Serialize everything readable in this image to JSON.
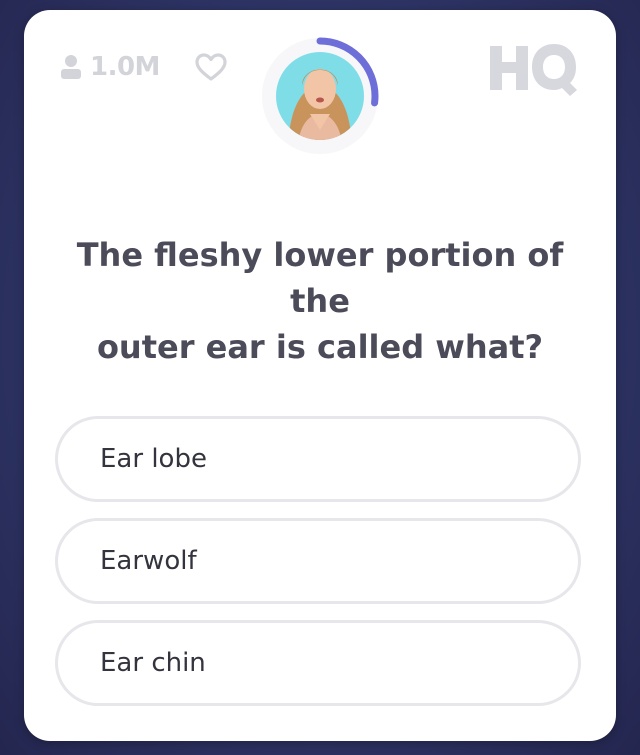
{
  "header": {
    "viewer_count": "1.0M",
    "logo_text": "HQ",
    "timer_progress": 0.27,
    "icons": {
      "viewers": "person-icon",
      "like": "heart-icon",
      "host": "host-avatar"
    }
  },
  "question": {
    "line1": "The fleshy lower portion of the",
    "line2": "outer ear is called what?"
  },
  "answers": [
    {
      "label": "Ear lobe"
    },
    {
      "label": "Earwolf"
    },
    {
      "label": "Ear chin"
    }
  ],
  "colors": {
    "timer_ring": "#6d6ed8",
    "avatar_background": "#7fdde8",
    "logo": "#d7d7de",
    "muted_text": "#d3d4da",
    "question_text": "#4b4b59"
  }
}
